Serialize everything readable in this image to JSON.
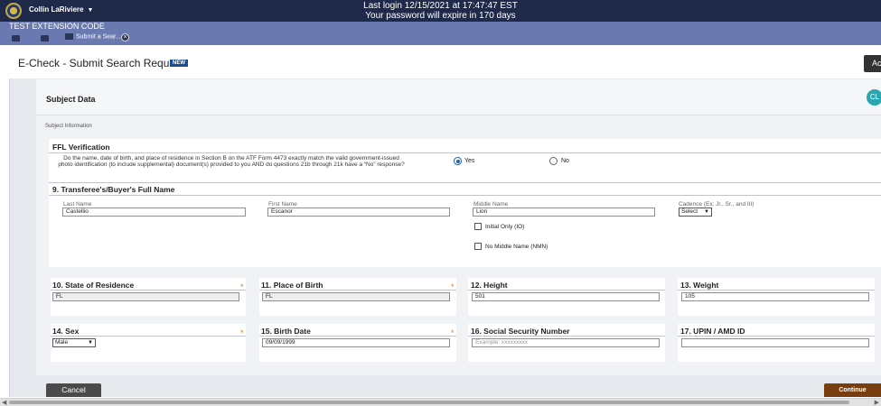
{
  "topbar": {
    "user_name": "Collin LaRiviere",
    "last_login": "Last login 12/15/2021 at 17:47:47 EST",
    "password_notice": "Your password will expire in 170 days"
  },
  "subbar": {
    "extension_code": "TEST EXTENSION CODE",
    "tab_label": "Submit a Sear..."
  },
  "page": {
    "title": "E-Check - Submit Search Request",
    "new_badge": "NEW",
    "add_button": "Ac"
  },
  "subject": {
    "header": "Subject Data",
    "avatar": "CL",
    "info_label": "Subject Information"
  },
  "ffl": {
    "title": "FFL Verification",
    "question": "Do the name, date of birth, and place of residence in Section B on the ATF Form 4473 exactly match the valid government-issued photo identification (to include supplemental) document(s) provided to you AND do questions 21b through 21k have a “No” response?",
    "options": [
      {
        "label": "Yes",
        "selected": true
      },
      {
        "label": "No",
        "selected": false
      }
    ]
  },
  "name_section": {
    "title": "9. Transferee's/Buyer's Full Name",
    "last_name": {
      "label": "Last Name",
      "value": "Castellio"
    },
    "first_name": {
      "label": "First Name",
      "value": "Escanor"
    },
    "middle_name": {
      "label": "Middle Name",
      "value": "Lion"
    },
    "cadence": {
      "label": "Cadence (Ex: Jr., Sr., and III)",
      "value": "Select"
    },
    "initial_only": "Initial Only (IO)",
    "no_middle_name": "No Middle Name (NMN)"
  },
  "fields": {
    "state": {
      "title": "10. State of Residence",
      "value": "FL"
    },
    "place_of_birth": {
      "title": "11. Place of Birth",
      "value": "FL"
    },
    "height": {
      "title": "12. Height",
      "value": "501"
    },
    "weight": {
      "title": "13. Weight",
      "value": "105"
    },
    "sex": {
      "title": "14. Sex",
      "value": "Male"
    },
    "birth_date": {
      "title": "15. Birth Date",
      "value": "09/09/1999"
    },
    "ssn": {
      "title": "16. Social Security Number",
      "placeholder": "Example: xxxxxxxxx"
    },
    "upin": {
      "title": "17. UPIN / AMD ID",
      "value": ""
    }
  },
  "required_mark": "*",
  "actions": {
    "cancel": "Cancel",
    "continue": "Continue"
  },
  "colors": {
    "topbar": "#1f2a4a",
    "subbar": "#6a7ab0",
    "required": "#e07b22",
    "continue": "#7a3e0e",
    "avatar": "#2aa6b0"
  }
}
